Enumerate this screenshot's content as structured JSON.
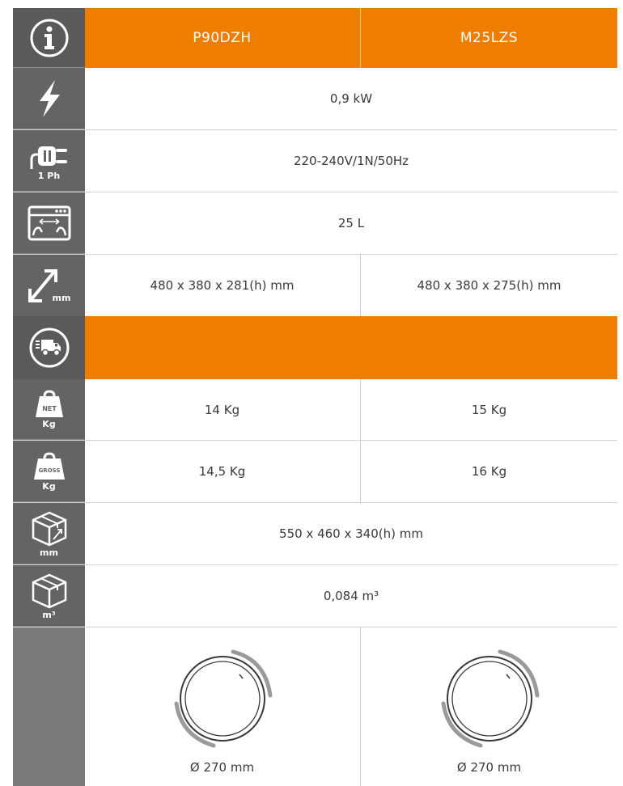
{
  "header": {
    "models": [
      "P90DZH",
      "M25LZS"
    ]
  },
  "specs": {
    "power": "0,9 kW",
    "electrical": "220-240V/1N/50Hz",
    "capacity": "25 L",
    "dimensions": [
      "480 x 380 x 281(h) mm",
      "480 x 380 x 275(h) mm"
    ]
  },
  "shipping": {
    "net_weight": [
      "14 Kg",
      "15 Kg"
    ],
    "gross_weight": [
      "14,5 Kg",
      "16 Kg"
    ],
    "package_dimensions": "550 x 460 x 340(h) mm",
    "package_volume": "0,084 m³"
  },
  "turntable": {
    "diameters": [
      "Ø 270 mm",
      "Ø 270 mm"
    ]
  },
  "icons": {
    "info": "info-icon",
    "power": "lightning-bolt-icon",
    "plug": "plug-icon",
    "plug_label": "1 Ph",
    "capacity": "oven-capacity-icon",
    "dimensions": "dimensions-arrow-icon",
    "dimensions_unit": "mm",
    "delivery": "delivery-truck-icon",
    "net": "net-weight-icon",
    "net_label": "NET",
    "net_unit": "Kg",
    "gross": "gross-weight-icon",
    "gross_label": "GROSS",
    "gross_unit": "Kg",
    "box_dims": "box-dimensions-icon",
    "box_dims_unit": "mm",
    "box_volume": "box-volume-icon",
    "box_volume_unit": "m³"
  },
  "colors": {
    "accent": "#ee7d00",
    "icon_bg": "#646464"
  }
}
